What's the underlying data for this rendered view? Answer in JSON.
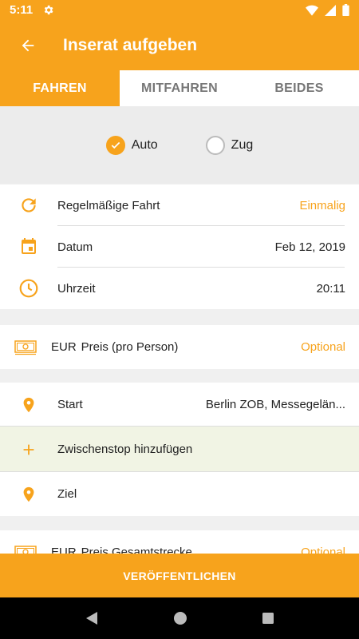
{
  "status_bar": {
    "time": "5:11"
  },
  "app_bar": {
    "title": "Inserat aufgeben"
  },
  "tabs": [
    {
      "label": "FAHREN",
      "active": true
    },
    {
      "label": "MITFAHREN",
      "active": false
    },
    {
      "label": "BEIDES",
      "active": false
    }
  ],
  "transport": {
    "auto_label": "Auto",
    "auto_checked": true,
    "zug_label": "Zug",
    "zug_checked": false
  },
  "schedule": {
    "recurring_label": "Regelmäßige Fahrt",
    "recurring_value": "Einmalig",
    "date_label": "Datum",
    "date_value": "Feb 12, 2019",
    "time_label": "Uhrzeit",
    "time_value": "20:11"
  },
  "price": {
    "currency": "EUR",
    "label": "Preis (pro Person)",
    "value": "Optional"
  },
  "route": {
    "start_label": "Start",
    "start_value": "Berlin ZOB, Messegelän...",
    "stop_label": "Zwischenstop hinzufügen",
    "dest_label": "Ziel"
  },
  "total_price": {
    "currency": "EUR",
    "label": "Preis Gesamtstrecke",
    "value": "Optional"
  },
  "publish_label": "VERÖFFENTLICHEN",
  "colors": {
    "accent": "#f7a31c",
    "highlight": "#f1f4e4"
  }
}
